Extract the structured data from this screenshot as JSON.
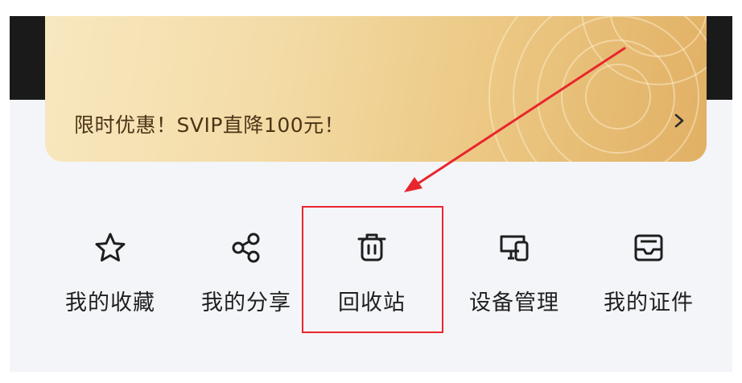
{
  "promo": {
    "text": "限时优惠！SVIP直降100元！",
    "chevron_icon": "chevron-right-icon"
  },
  "menu": {
    "items": [
      {
        "label": "我的收藏",
        "icon": "star-icon"
      },
      {
        "label": "我的分享",
        "icon": "share-icon"
      },
      {
        "label": "回收站",
        "icon": "trash-icon"
      },
      {
        "label": "设备管理",
        "icon": "devices-icon"
      },
      {
        "label": "我的证件",
        "icon": "id-card-icon"
      }
    ]
  },
  "annotation": {
    "color": "#e8262d",
    "highlighted_item": "回收站"
  },
  "colors": {
    "promo_text": "#4b3516",
    "background": "#f4f5f9"
  }
}
